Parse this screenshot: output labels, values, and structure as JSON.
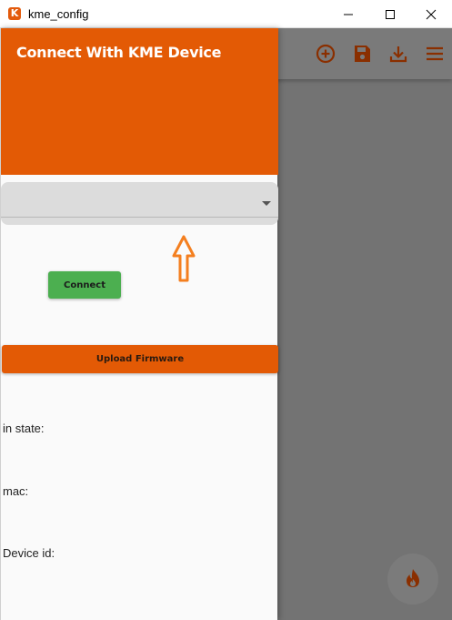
{
  "window": {
    "title": "kme_config",
    "icon_letter": "K"
  },
  "colors": {
    "accent": "#e35a05",
    "connect": "#4caf50",
    "scrim": "#737373",
    "action_icon": "#8a2f00"
  },
  "app_bar": {
    "actions": [
      "add-circle-icon",
      "save-icon",
      "download-icon",
      "menu-icon"
    ]
  },
  "drawer": {
    "title": "Connect With KME Device",
    "device_select": {
      "value": ""
    },
    "connect_label": "Connect",
    "upload_label": "Upload Firmware",
    "info": {
      "state_label": "in state:",
      "mac_label": "mac:",
      "device_id_label": "Device id:"
    }
  },
  "fab": {
    "icon": "flame-icon"
  }
}
